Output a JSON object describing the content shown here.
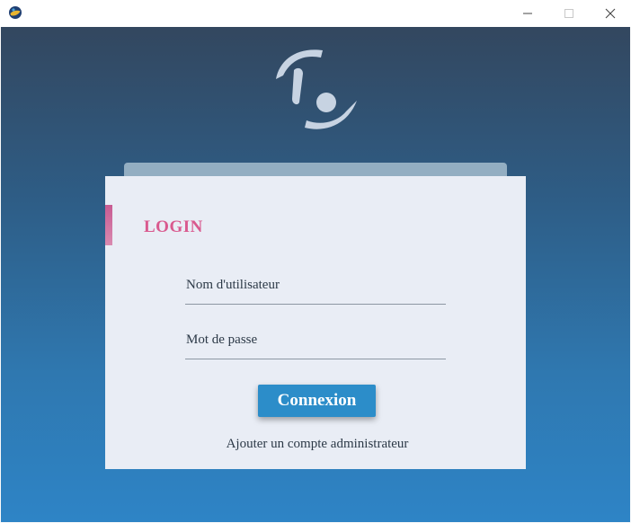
{
  "window": {
    "icon": "app-globe-icon",
    "controls": [
      "minimize-icon",
      "maximize-icon",
      "close-icon"
    ]
  },
  "logo": {
    "icon": "swirl-logo-icon",
    "color": "#c7d3e2"
  },
  "login": {
    "title": "LOGIN",
    "username_placeholder": "Nom d'utilisateur",
    "password_placeholder": "Mot de passe",
    "submit_label": "Connexion",
    "admin_link": "Ajouter un compte administrateur"
  },
  "colors": {
    "accent": "#d9598e",
    "button": "#2c8dc9",
    "card": "#e9edf5",
    "gradient_top": "#33475f",
    "gradient_bottom": "#2e84c6"
  }
}
